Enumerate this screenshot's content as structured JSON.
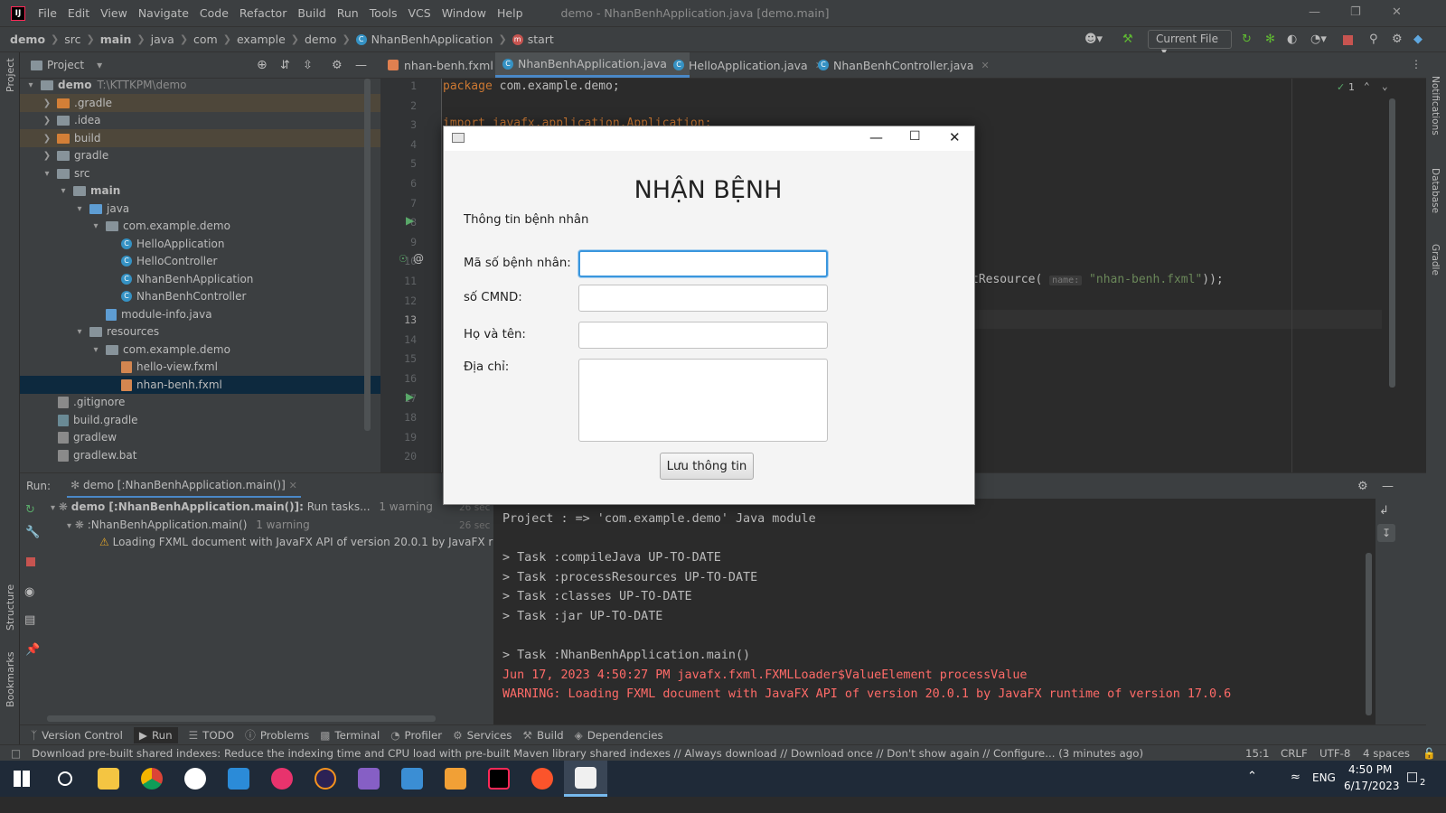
{
  "menubar": {
    "items": [
      "File",
      "Edit",
      "View",
      "Navigate",
      "Code",
      "Refactor",
      "Build",
      "Run",
      "Tools",
      "VCS",
      "Window",
      "Help"
    ],
    "window_title": "demo - NhanBenhApplication.java [demo.main]"
  },
  "navbar": {
    "crumbs": [
      "demo",
      "src",
      "main",
      "java",
      "com",
      "example",
      "demo"
    ],
    "class_crumb": "NhanBenhApplication",
    "method_crumb": "start",
    "run_config": "Current File"
  },
  "project": {
    "title": "Project",
    "root_name": "demo",
    "root_path": "T:\\KTTKPM\\demo",
    "nodes": [
      ".gradle",
      ".idea",
      "build",
      "gradle",
      "src",
      "main",
      "java",
      "com.example.demo",
      "HelloApplication",
      "HelloController",
      "NhanBenhApplication",
      "NhanBenhController",
      "module-info.java",
      "resources",
      "com.example.demo",
      "hello-view.fxml",
      "nhan-benh.fxml",
      ".gitignore",
      "build.gradle",
      "gradlew",
      "gradlew.bat"
    ]
  },
  "tabs": [
    "nhan-benh.fxml",
    "NhanBenhApplication.java",
    "HelloApplication.java",
    "NhanBenhController.java"
  ],
  "editor": {
    "line_numbers": [
      "1",
      "2",
      "3",
      "4",
      "5",
      "6",
      "7",
      "8",
      "9",
      "10",
      "11",
      "12",
      "13",
      "14",
      "15",
      "16",
      "17",
      "18",
      "19",
      "20"
    ],
    "line1_kw": "package",
    "line1_rest": " com.example.demo;",
    "line3": "import javafx.application.Application;",
    "line11_pre": "tResource(",
    "line11_hint": "name:",
    "line11_str": "\"nhan-benh.fxml\"",
    "line11_post": "));",
    "inspection_count": "1"
  },
  "run": {
    "label": "Run:",
    "tab": "demo [:NhanBenhApplication.main()]",
    "tree_root": "demo [:NhanBenhApplication.main()]:",
    "tree_root_suffix": "Run tasks...",
    "tree_root_warn": "1 warning",
    "tree_root_time": "26 sec",
    "tree_child": ":NhanBenhApplication.main()",
    "tree_child_warn": "1 warning",
    "tree_child_time": "26 sec",
    "tree_warning": "Loading FXML document with JavaFX API of version 20.0.1 by JavaFX runtime of v",
    "console": [
      "Project : => 'com.example.demo' Java module",
      "",
      "> Task :compileJava UP-TO-DATE",
      "> Task :processResources UP-TO-DATE",
      "> Task :classes UP-TO-DATE",
      "> Task :jar UP-TO-DATE",
      "",
      "> Task :NhanBenhApplication.main()"
    ],
    "console_errors": [
      "Jun 17, 2023 4:50:27 PM javafx.fxml.FXMLLoader$ValueElement processValue",
      "WARNING: Loading FXML document with JavaFX API of version 20.0.1 by JavaFX runtime of version 17.0.6"
    ]
  },
  "bottom_tools": [
    "Version Control",
    "Run",
    "TODO",
    "Problems",
    "Terminal",
    "Profiler",
    "Services",
    "Build",
    "Dependencies"
  ],
  "statusbar": {
    "message": "Download pre-built shared indexes: Reduce the indexing time and CPU load with pre-built Maven library shared indexes // Always download // Download once // Don't show again // Configure... (3 minutes ago)",
    "position": "15:1",
    "line_sep": "CRLF",
    "encoding": "UTF-8",
    "indent": "4 spaces"
  },
  "left_stripe": [
    "Project",
    "Structure",
    "Bookmarks"
  ],
  "right_stripe": [
    "Notifications",
    "Database",
    "Gradle"
  ],
  "dialog": {
    "heading": "NHẬN BỆNH",
    "section": "Thông tin bệnh nhân",
    "label_id": "Mã số bệnh nhân:",
    "label_cmnd": "số CMND:",
    "label_name": "Họ và tên:",
    "label_address": "Địa chỉ:",
    "save_button": "Lưu thông tin"
  },
  "taskbar": {
    "lang": "ENG",
    "time": "4:50 PM",
    "date": "6/17/2023",
    "notif_count": "2"
  },
  "colors": {
    "accent": "#4a88c7",
    "error": "#ff6b68",
    "dialog_focus": "#3a96dd"
  }
}
